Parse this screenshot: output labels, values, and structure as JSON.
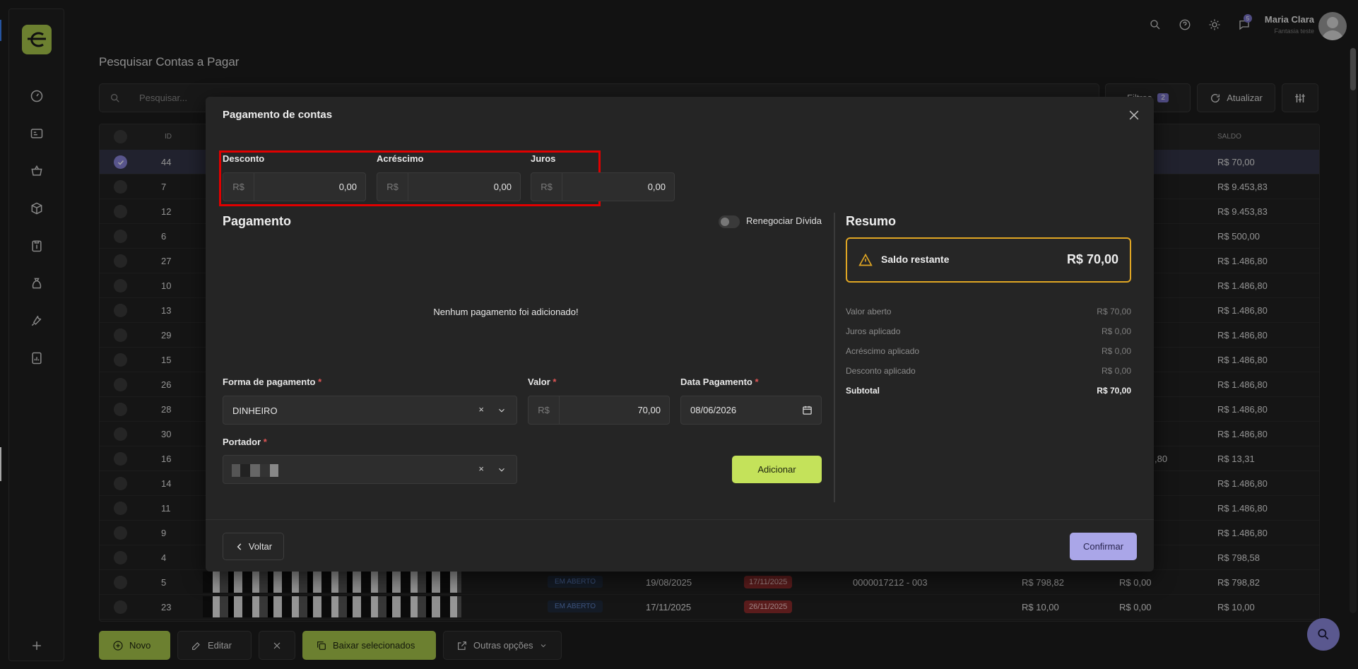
{
  "user": {
    "name": "Maria Clara",
    "company": "Fantasia teste",
    "notification_count": "5"
  },
  "page": {
    "title": "Pesquisar Contas a Pagar",
    "search_placeholder": "Pesquisar...",
    "filters_label": "Filtros",
    "filters_count": "2",
    "refresh_label": "Atualizar"
  },
  "table": {
    "headers": {
      "id": "ID",
      "saldo": "SALDO"
    },
    "rows": [
      {
        "id": "44",
        "saldo": "R$ 70,00",
        "selected": true
      },
      {
        "id": "7",
        "saldo": "R$ 9.453,83"
      },
      {
        "id": "12",
        "saldo": "R$ 9.453,83"
      },
      {
        "id": "6",
        "saldo": "R$ 500,00"
      },
      {
        "id": "27",
        "saldo": "R$ 1.486,80"
      },
      {
        "id": "10",
        "saldo": "R$ 1.486,80"
      },
      {
        "id": "13",
        "saldo": "R$ 1.486,80"
      },
      {
        "id": "29",
        "saldo": "R$ 1.486,80"
      },
      {
        "id": "15",
        "saldo": "R$ 1.486,80"
      },
      {
        "id": "26",
        "saldo": "R$ 1.486,80"
      },
      {
        "id": "28",
        "saldo": "R$ 1.486,80"
      },
      {
        "id": "30",
        "saldo": "R$ 1.486,80"
      },
      {
        "id": "16",
        "saldo": "R$ 13,31",
        "partial": ",80"
      },
      {
        "id": "14",
        "saldo": "R$ 1.486,80"
      },
      {
        "id": "11",
        "saldo": "R$ 1.486,80"
      },
      {
        "id": "9",
        "saldo": "R$ 1.486,80"
      },
      {
        "id": "4",
        "saldo": "R$ 798,58"
      },
      {
        "id": "5",
        "status": "EM ABERTO",
        "emissao": "19/08/2025",
        "vencimento": "17/11/2025",
        "documento": "0000017212 - 003",
        "valor": "R$ 798,82",
        "pago": "R$ 0,00",
        "saldo": "R$ 798,82"
      },
      {
        "id": "23",
        "status": "EM ABERTO",
        "emissao": "17/11/2025",
        "vencimento": "26/11/2025",
        "documento": "",
        "valor": "R$ 10,00",
        "pago": "R$ 0,00",
        "saldo": "R$ 10,00"
      }
    ]
  },
  "bottom_bar": {
    "novo": "Novo",
    "editar": "Editar",
    "baixar": "Baixar selecionados",
    "outras": "Outras opções"
  },
  "modal": {
    "title": "Pagamento de contas",
    "desconto": {
      "label": "Desconto",
      "currency": "R$",
      "value": "0,00"
    },
    "acrescimo": {
      "label": "Acréscimo",
      "currency": "R$",
      "value": "0,00"
    },
    "juros": {
      "label": "Juros",
      "currency": "R$",
      "value": "0,00"
    },
    "pagamento_title": "Pagamento",
    "renegociar_label": "Renegociar Dívida",
    "renegociar_on": false,
    "empty_message": "Nenhum pagamento foi adicionado!",
    "forma_label": "Forma de pagamento",
    "forma_value": "DINHEIRO",
    "valor_label": "Valor",
    "valor_currency": "R$",
    "valor_value": "70,00",
    "data_label": "Data Pagamento",
    "data_value": "08/06/2026",
    "portador_label": "Portador",
    "required_mark": "*",
    "clear_mark": "×",
    "add_label": "Adicionar",
    "resumo": {
      "title": "Resumo",
      "saldo_label": "Saldo restante",
      "saldo_value": "R$ 70,00",
      "rows": [
        {
          "label": "Valor aberto",
          "value": "R$ 70,00"
        },
        {
          "label": "Juros aplicado",
          "value": "R$ 0,00"
        },
        {
          "label": "Acréscimo aplicado",
          "value": "R$ 0,00"
        },
        {
          "label": "Desconto aplicado",
          "value": "R$ 0,00"
        }
      ],
      "subtotal_label": "Subtotal",
      "subtotal_value": "R$ 70,00"
    },
    "back_label": "Voltar",
    "confirm_label": "Confirmar"
  },
  "colors": {
    "accent_green": "#a7c54a",
    "accent_purple": "#8783d8",
    "warning": "#e0a624",
    "highlight": "#e00000"
  }
}
